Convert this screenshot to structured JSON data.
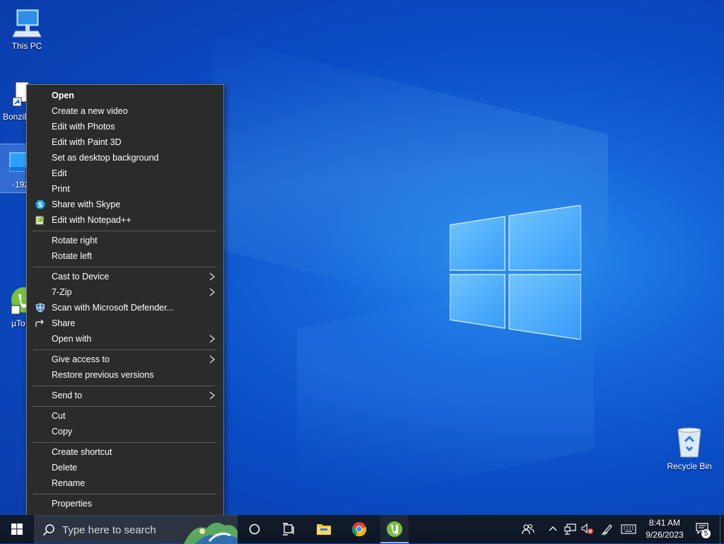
{
  "desktop": {
    "icons": [
      {
        "label": "This PC"
      },
      {
        "label": "BonziB"
      },
      {
        "label": "-192"
      },
      {
        "label": "µTo"
      },
      {
        "label": "Recycle Bin"
      }
    ]
  },
  "context_menu": {
    "items": [
      {
        "label": "Open"
      },
      {
        "label": "Create a new video"
      },
      {
        "label": "Edit with Photos"
      },
      {
        "label": "Edit with Paint 3D"
      },
      {
        "label": "Set as desktop background"
      },
      {
        "label": "Edit"
      },
      {
        "label": "Print"
      },
      {
        "label": "Share with Skype",
        "icon": "skype-icon"
      },
      {
        "label": "Edit with Notepad++",
        "icon": "notepad-plus-plus-icon"
      },
      {
        "label": "Rotate right"
      },
      {
        "label": "Rotate left"
      },
      {
        "label": "Cast to Device"
      },
      {
        "label": "7-Zip"
      },
      {
        "label": "Scan with Microsoft Defender...",
        "icon": "defender-shield-icon"
      },
      {
        "label": "Share",
        "icon": "share-icon"
      },
      {
        "label": "Open with"
      },
      {
        "label": "Give access to"
      },
      {
        "label": "Restore previous versions"
      },
      {
        "label": "Send to"
      },
      {
        "label": "Cut"
      },
      {
        "label": "Copy"
      },
      {
        "label": "Create shortcut"
      },
      {
        "label": "Delete"
      },
      {
        "label": "Rename"
      },
      {
        "label": "Properties"
      }
    ]
  },
  "taskbar": {
    "search_placeholder": "Type here to search",
    "pinned": [
      "start-icon",
      "search-icon",
      "cortana-icon",
      "task-view-icon",
      "file-explorer-icon",
      "chrome-icon",
      "utorrent-icon"
    ],
    "time": "8:41 AM",
    "date": "9/26/2023",
    "notification_count": "5"
  },
  "colors": {
    "menu_bg": "#2b2b2b",
    "taskbar_bg": "#101a2a",
    "desktop_accent": "#0a4cc4"
  }
}
